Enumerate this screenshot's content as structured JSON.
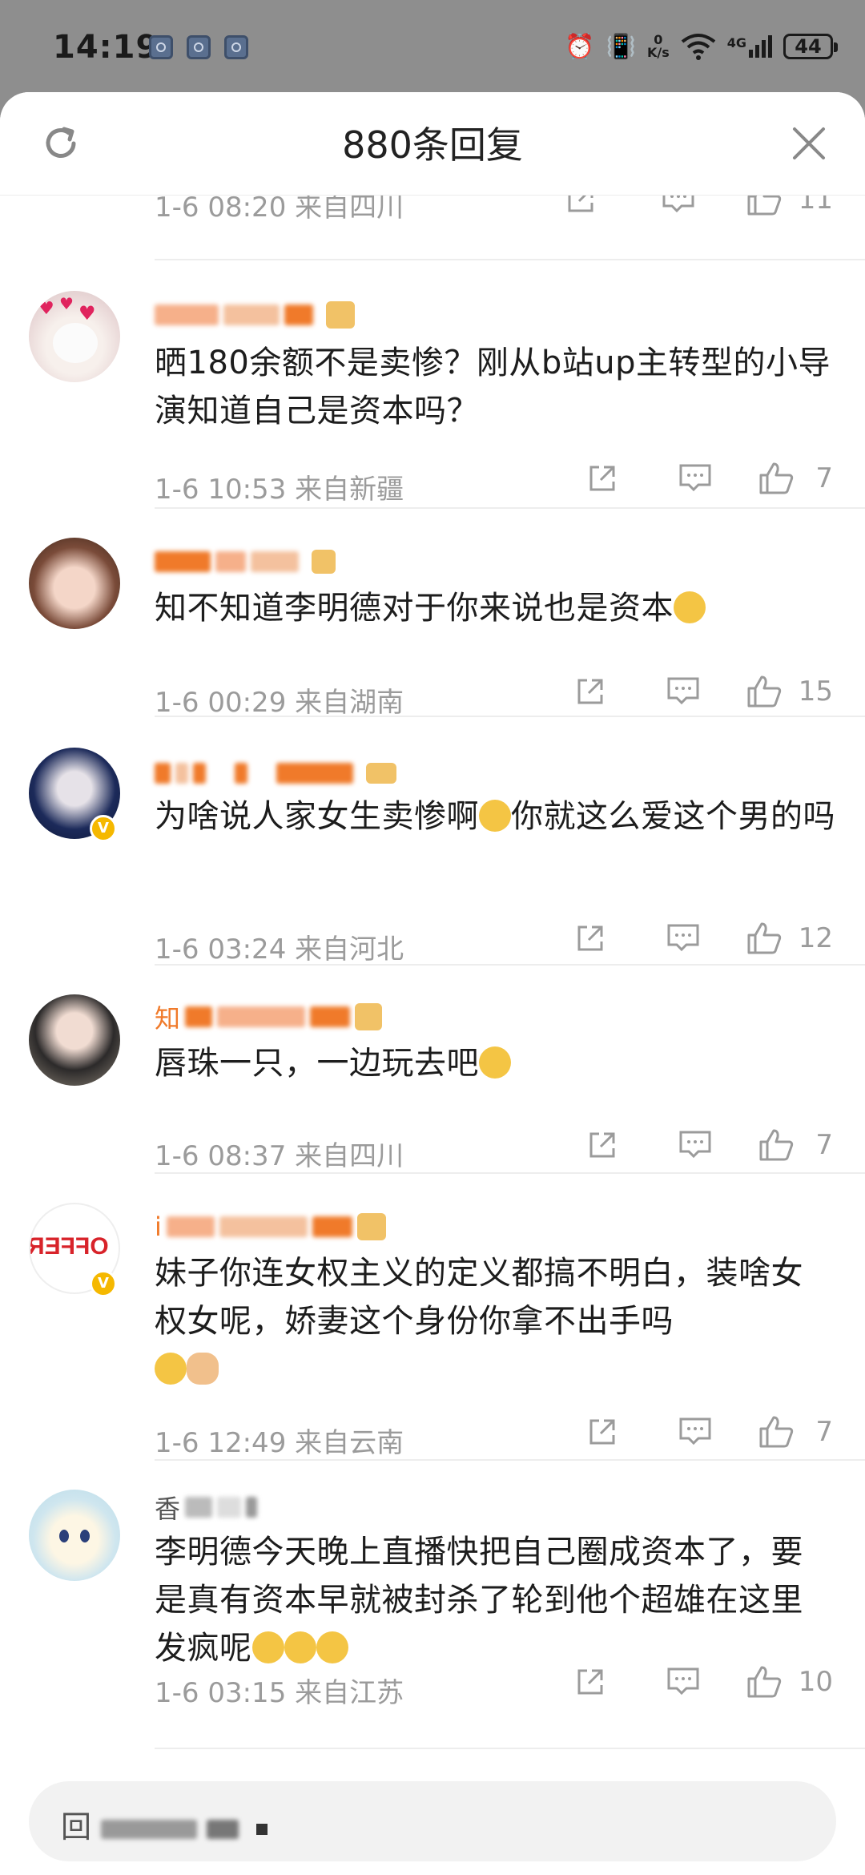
{
  "status": {
    "time": "14:19",
    "net_speed_value": "0",
    "net_speed_unit": "K/s",
    "network": "4G",
    "battery": "44"
  },
  "header": {
    "title": "880条回复"
  },
  "top_partial": {
    "time": "1-6 08:20",
    "location": "来自四川",
    "likes": "11"
  },
  "comments": [
    {
      "text": "晒180余额不是卖惨？刚从b站up主转型的小导演知道自己是资本吗？",
      "time": "1-6 10:53",
      "location": "来自新疆",
      "likes": "7"
    },
    {
      "text": "知不知道李明德对于你来说也是资本",
      "time": "1-6 00:29",
      "location": "来自湖南",
      "likes": "15"
    },
    {
      "text_a": "为啥说人家女生卖惨啊",
      "text_b": "你就这么爱这个男的吗",
      "time": "1-6 03:24",
      "location": "来自河北",
      "likes": "12"
    },
    {
      "text": "唇珠一只，一边玩去吧",
      "name_visible": "知",
      "time": "1-6 08:37",
      "location": "来自四川",
      "likes": "7"
    },
    {
      "text": "妹子你连女权主义的定义都搞不明白，装啥女权女呢，娇妻这个身份你拿不出手吗",
      "name_visible": "i",
      "avatar_text": "OFFER",
      "time": "1-6 12:49",
      "location": "来自云南",
      "likes": "7"
    },
    {
      "text": "李明德今天晚上直播快把自己圈成资本了，要是真有资本早就被封杀了轮到他个超雄在这里发疯呢",
      "name_visible": "香",
      "time": "1-6 03:15",
      "location": "来自江苏",
      "likes": "10"
    }
  ],
  "reply_bar": {
    "placeholder": "回"
  },
  "colors": {
    "meta": "#9b9b9b",
    "badge": "#f5b800",
    "blur_orange": "#f07a2a"
  }
}
